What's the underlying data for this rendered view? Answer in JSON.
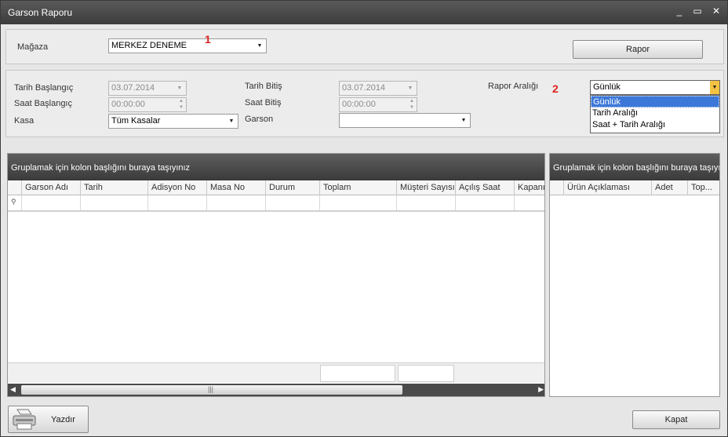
{
  "window": {
    "title": "Garson Raporu",
    "minimize": "_",
    "maximize": "▭",
    "close": "✕"
  },
  "top": {
    "magaza_label": "Mağaza",
    "magaza_value": "MERKEZ DENEME",
    "annotation_1": "1",
    "rapor_button": "Rapor"
  },
  "filters": {
    "tarih_baslangic_label": "Tarih Başlangıç",
    "tarih_baslangic_value": "03.07.2014",
    "saat_baslangic_label": "Saat Başlangıç",
    "saat_baslangic_value": "00:00:00",
    "kasa_label": "Kasa",
    "kasa_value": "Tüm Kasalar",
    "tarih_bitis_label": "Tarih Bitiş",
    "tarih_bitis_value": "03.07.2014",
    "saat_bitis_label": "Saat Bitiş",
    "saat_bitis_value": "00:00:00",
    "garson_label": "Garson",
    "garson_value": "",
    "rapor_araligi_label": "Rapor Aralığı",
    "annotation_2": "2",
    "rapor_araligi_value": "Günlük",
    "rapor_araligi_options": [
      "Günlük",
      "Tarih Aralığı",
      "Saat + Tarih Aralığı"
    ]
  },
  "left_grid": {
    "group_hint": "Gruplamak için kolon başlığını buraya taşıyınız",
    "columns": [
      "Garson Adı",
      "Tarih",
      "Adisyon No",
      "Masa No",
      "Durum",
      "Toplam",
      "Müşteri Sayısı",
      "Açılış Saat",
      "Kapanış"
    ]
  },
  "right_grid": {
    "group_hint": "Gruplamak için kolon başlığını buraya taşıyın",
    "columns": [
      "Ürün Açıklaması",
      "Adet",
      "Top..."
    ]
  },
  "bottom": {
    "yazdir_button": "Yazdır",
    "kapat_button": "Kapat"
  },
  "colors": {
    "accent": "#3c78d8",
    "annotation": "#e02020",
    "header_dark": "#3a3a3a"
  }
}
